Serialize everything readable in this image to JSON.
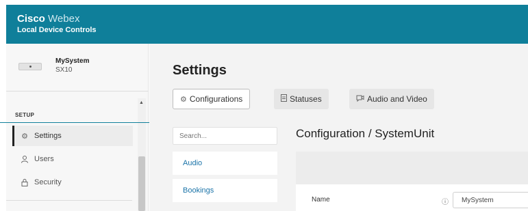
{
  "header": {
    "brand_bold": "Cisco",
    "brand_light": "Webex",
    "subtitle": "Local Device Controls",
    "background_color": "#0f7f9a"
  },
  "sidebar": {
    "device_name": "MySystem",
    "device_model": "SX10",
    "section_title": "SETUP",
    "items": [
      {
        "label": "Settings",
        "icon": "gear-icon",
        "active": true
      },
      {
        "label": "Users",
        "icon": "user-icon",
        "active": false
      },
      {
        "label": "Security",
        "icon": "lock-icon",
        "active": false
      }
    ]
  },
  "main": {
    "title": "Settings",
    "tabs": [
      {
        "label": "Configurations",
        "icon": "gear-icon",
        "active": true
      },
      {
        "label": "Statuses",
        "icon": "document-icon",
        "active": false
      },
      {
        "label": "Audio and Video",
        "icon": "audio-video-icon",
        "active": false
      }
    ],
    "search_placeholder": "Search...",
    "categories": [
      "Audio",
      "Bookings"
    ],
    "config_title": "Configuration / SystemUnit",
    "fields": [
      {
        "label": "Name",
        "value": "MySystem"
      }
    ]
  }
}
